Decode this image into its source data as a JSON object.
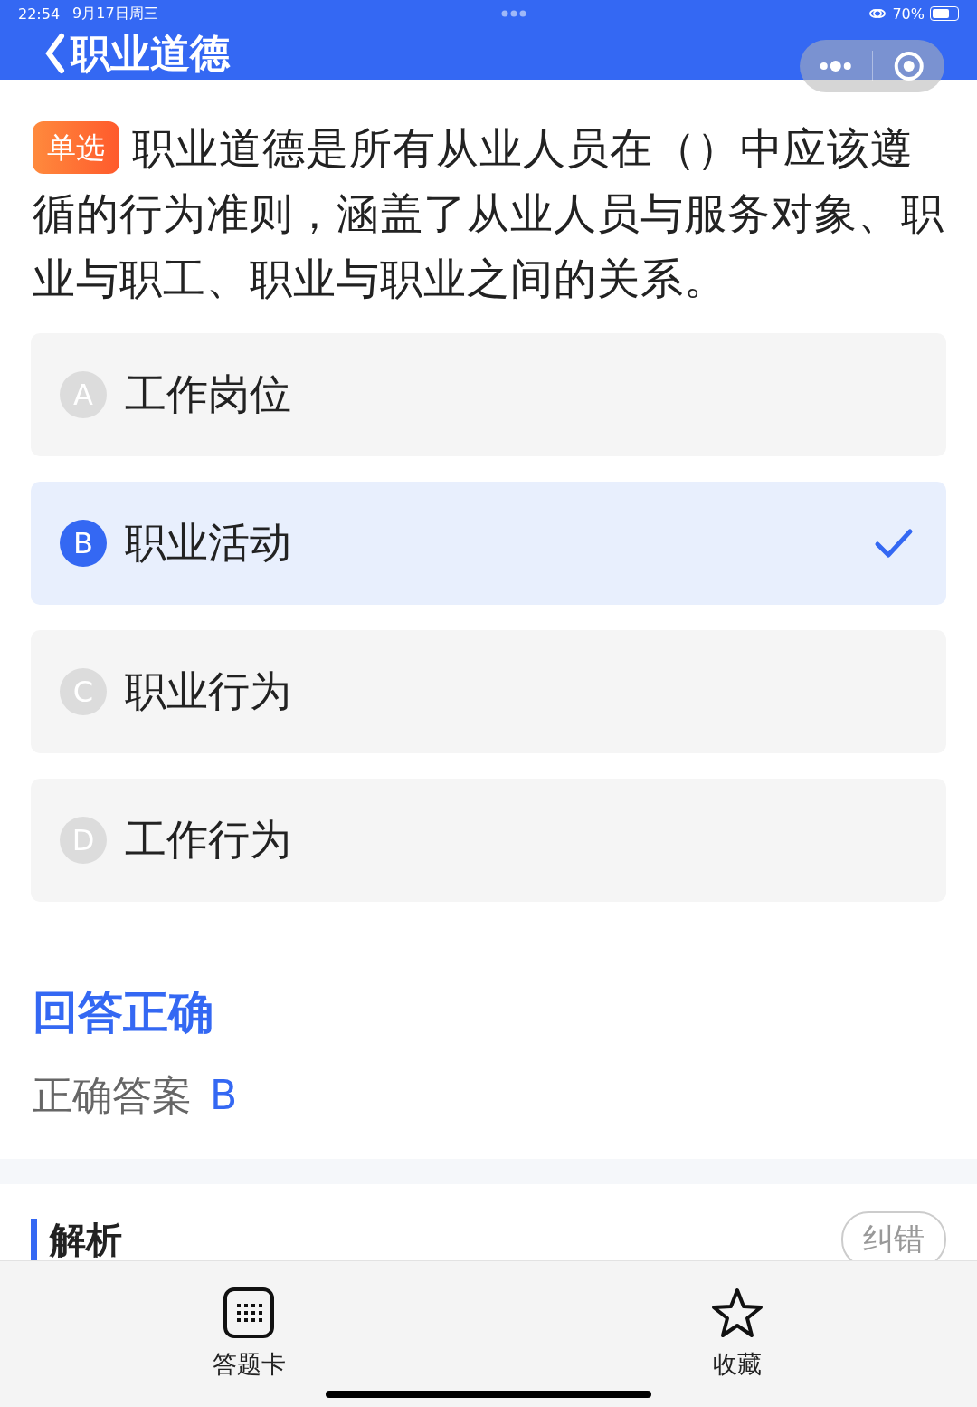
{
  "status_bar": {
    "time": "22:54",
    "date": "9月17日周三",
    "battery": "70%"
  },
  "header": {
    "title": "职业道德"
  },
  "question": {
    "type_badge": "单选",
    "text": "职业道德是所有从业人员在（）中应该遵循的行为准则，涵盖了从业人员与服务对象、职业与职工、职业与职业之间的关系。"
  },
  "options": [
    {
      "letter": "A",
      "text": "工作岗位",
      "selected": false
    },
    {
      "letter": "B",
      "text": "职业活动",
      "selected": true
    },
    {
      "letter": "C",
      "text": "职业行为",
      "selected": false
    },
    {
      "letter": "D",
      "text": "工作行为",
      "selected": false
    }
  ],
  "result": {
    "title": "回答正确",
    "answer_label": "正确答案",
    "answer": "B"
  },
  "analysis": {
    "title": "解析",
    "correction_button": "纠错"
  },
  "bottom_bar": [
    {
      "kind": "grid",
      "label": "答题卡"
    },
    {
      "kind": "star",
      "label": "收藏"
    }
  ]
}
